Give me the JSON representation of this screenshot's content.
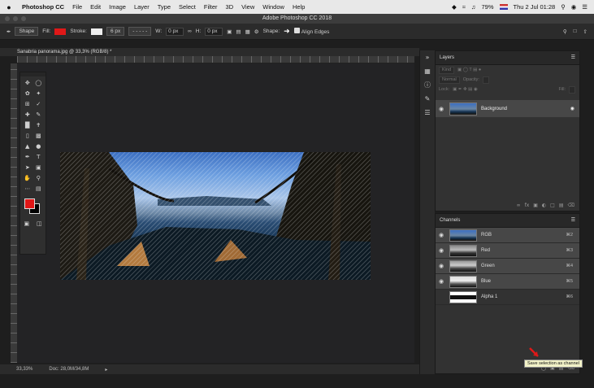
{
  "menubar": {
    "apple": "",
    "items": [
      "Photoshop CC",
      "File",
      "Edit",
      "Image",
      "Layer",
      "Type",
      "Select",
      "Filter",
      "3D",
      "View",
      "Window",
      "Help"
    ],
    "battery": "79%",
    "datetime": "Thu 2 Jul  01:28"
  },
  "titlebar": {
    "title": "Adobe Photoshop CC 2018"
  },
  "options": {
    "mode": "Shape",
    "fill_label": "Fill:",
    "stroke_label": "Stroke:",
    "stroke_width": "6 px",
    "w_label": "W:",
    "w_value": "0 px",
    "h_label": "H:",
    "h_value": "0 px",
    "shape_label": "Shape:",
    "align_edges": "Align Edges",
    "fill_color": "#e01818"
  },
  "document": {
    "tab": "Sanabria panorama.jpg @ 33,3% (RGB/8) *",
    "zoom": "33,33%",
    "doc_size": "Doc: 28,0M/34,8M"
  },
  "tools": {
    "icons": [
      "move-icon",
      "marquee-icon",
      "lasso-icon",
      "magic-wand-icon",
      "crop-icon",
      "eyedropper-icon",
      "healing-icon",
      "brush-icon",
      "stamp-icon",
      "history-brush-icon",
      "eraser-icon",
      "gradient-icon",
      "blur-icon",
      "dodge-icon",
      "pen-icon",
      "type-icon",
      "path-select-icon",
      "shape-icon",
      "hand-icon",
      "zoom-icon"
    ],
    "foreground": "#e01616",
    "background": "#000000"
  },
  "layers": {
    "title": "Layers",
    "filter": "Kind",
    "blend_mode": "Normal",
    "opacity_label": "Opacity:",
    "lock_label": "Lock:",
    "fill_label": "Fill:",
    "items": [
      {
        "name": "Background"
      }
    ]
  },
  "channels": {
    "title": "Channels",
    "items": [
      {
        "name": "RGB",
        "shortcut": "⌘2"
      },
      {
        "name": "Red",
        "shortcut": "⌘3"
      },
      {
        "name": "Green",
        "shortcut": "⌘4"
      },
      {
        "name": "Blue",
        "shortcut": "⌘5"
      },
      {
        "name": "Alpha 1",
        "shortcut": "⌘6"
      }
    ]
  },
  "tooltip": "Save selection as channel"
}
